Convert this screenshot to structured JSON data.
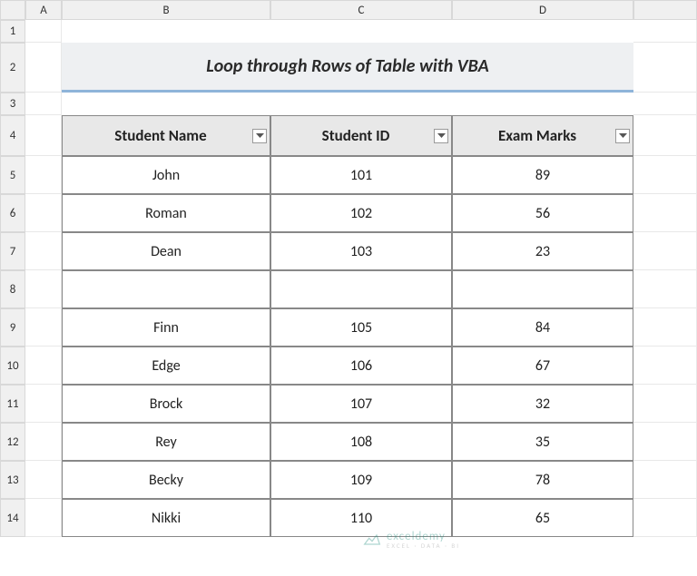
{
  "columns": [
    "A",
    "B",
    "C",
    "D"
  ],
  "rows": [
    "1",
    "2",
    "3",
    "4",
    "5",
    "6",
    "7",
    "8",
    "9",
    "10",
    "11",
    "12",
    "13",
    "14"
  ],
  "title": "Loop through Rows of Table with VBA",
  "headers": {
    "name": "Student Name",
    "id": "Student ID",
    "marks": "Exam Marks"
  },
  "chart_data": {
    "type": "table",
    "columns": [
      "Student Name",
      "Student ID",
      "Exam Marks"
    ],
    "rows": [
      {
        "name": "John",
        "id": "101",
        "marks": "89"
      },
      {
        "name": "Roman",
        "id": "102",
        "marks": "56"
      },
      {
        "name": "Dean",
        "id": "103",
        "marks": "23"
      },
      {
        "name": "",
        "id": "",
        "marks": ""
      },
      {
        "name": "Finn",
        "id": "105",
        "marks": "84"
      },
      {
        "name": "Edge",
        "id": "106",
        "marks": "67"
      },
      {
        "name": "Brock",
        "id": "107",
        "marks": "32"
      },
      {
        "name": "Rey",
        "id": "108",
        "marks": "35"
      },
      {
        "name": "Becky",
        "id": "109",
        "marks": "78"
      },
      {
        "name": "Nikki",
        "id": "110",
        "marks": "65"
      }
    ]
  },
  "watermark": {
    "brand": "exceldemy",
    "tagline": "EXCEL · DATA · BI"
  }
}
